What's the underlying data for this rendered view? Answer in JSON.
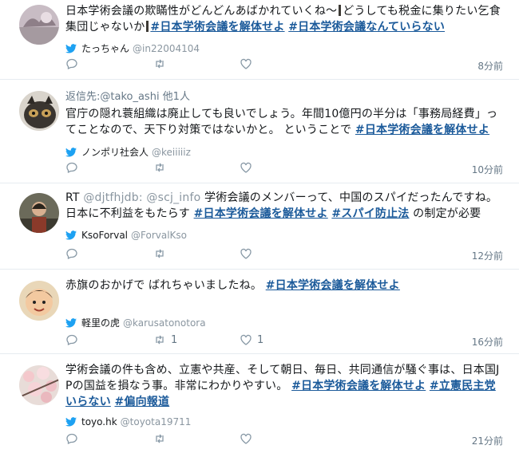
{
  "tweets": [
    {
      "text_parts": [
        {
          "t": "日本学術会議の欺瞞性がどんどんあばかれていくね〜"
        },
        {
          "bar": true
        },
        {
          "t": "どうしても税金に集りたい乞食集団じゃないか"
        },
        {
          "bar": true
        },
        {
          "t": "#日本学術会議を解体せよ",
          "tag": true
        },
        {
          "t": " "
        },
        {
          "t": "#日本学術会議なんていらない",
          "tag": true
        }
      ],
      "display_name": "たっちゃん",
      "handle": "@in22004104",
      "replies": "",
      "retweets": "",
      "likes": "",
      "time": "8分前"
    },
    {
      "reply_to": "返信先:@tako_ashi 他1人",
      "text_parts": [
        {
          "t": "官庁の隠れ蓑組織は廃止しても良いでしょう。年間10億円の半分は「事務局経費」ってことなので、天下り対策ではないかと。 ということで "
        },
        {
          "t": "#日本学術会議を解体せよ",
          "tag": true
        }
      ],
      "display_name": "ノンポリ社会人",
      "handle": "@keiiiiiz",
      "replies": "",
      "retweets": "",
      "likes": "",
      "time": "10分前"
    },
    {
      "text_parts": [
        {
          "t": "RT "
        },
        {
          "t": "@djtfhjdb: @scj_info",
          "mention": true
        },
        {
          "t": " 学術会議のメンバーって、中国のスパイだったんですね。 日本に不利益をもたらす "
        },
        {
          "t": "#日本学術会議を解体せよ",
          "tag": true
        },
        {
          "t": " "
        },
        {
          "t": "#スパイ防止法",
          "tag": true
        },
        {
          "t": " の制定が必要"
        }
      ],
      "display_name": "KsoForval",
      "handle": "@ForvalKso",
      "replies": "",
      "retweets": "",
      "likes": "",
      "time": "12分前"
    },
    {
      "text_parts": [
        {
          "t": "赤旗のおかげで ばれちゃいましたね。 "
        },
        {
          "t": "#日本学術会議を解体せよ",
          "tag": true
        }
      ],
      "display_name": "軽里の虎",
      "handle": "@karusatonotora",
      "replies": "",
      "retweets": "1",
      "likes": "1",
      "time": "16分前"
    },
    {
      "text_parts": [
        {
          "t": "学術会議の件も含め、立憲や共産、そして朝日、毎日、共同通信が騒ぐ事は、日本国JPの国益を損なう事。非常にわかりやすい。 "
        },
        {
          "t": "#日本学術会議を解体せよ",
          "tag": true
        },
        {
          "t": " "
        },
        {
          "t": "#立憲民主党いらない",
          "tag": true
        },
        {
          "t": " "
        },
        {
          "t": "#偏向報道",
          "tag": true
        }
      ],
      "display_name": "toyo.hk",
      "handle": "@toyota19711",
      "replies": "",
      "retweets": "",
      "likes": "",
      "time": "21分前"
    }
  ],
  "colors": {
    "hashtag": "#1b5a9a",
    "bird": "#1da1f2",
    "muted": "#657786"
  },
  "icons": {
    "reply": "reply-icon",
    "retweet": "retweet-icon",
    "like": "heart-icon",
    "bird": "twitter-bird-icon"
  }
}
